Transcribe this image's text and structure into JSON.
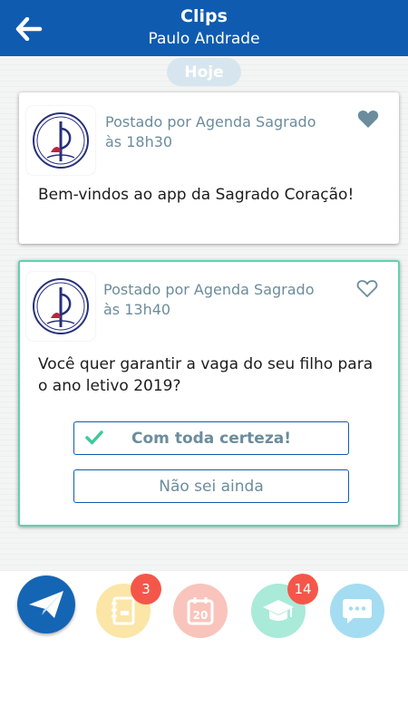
{
  "header": {
    "title": "Clips",
    "subtitle": "Paulo Andrade"
  },
  "feed": {
    "date_label": "Hoje",
    "posts": [
      {
        "posted_by": "Postado por Agenda Sagrado",
        "time": "às 18h30",
        "text": "Bem-vindos ao app da Sagrado Coração!",
        "liked": true
      },
      {
        "posted_by": "Postado por Agenda Sagrado",
        "time": "às 13h40",
        "text": "Você quer garantir a vaga do seu filho para o ano letivo 2019?",
        "liked": false,
        "options": [
          {
            "label": "Com toda certeza!",
            "selected": true
          },
          {
            "label": "Não sei ainda",
            "selected": false
          }
        ]
      }
    ]
  },
  "bottom_nav": {
    "items": [
      {
        "icon": "paper-plane-icon"
      },
      {
        "icon": "agenda-icon",
        "badge": "3"
      },
      {
        "icon": "calendar-icon",
        "calendar_day": "20"
      },
      {
        "icon": "graduation-cap-icon",
        "badge": "14"
      },
      {
        "icon": "chat-icon"
      }
    ]
  },
  "colors": {
    "header": "#0f5bb0",
    "accent_green": "#3ec99b",
    "meta_text": "#6b8c9c",
    "badge": "#f4574a"
  }
}
